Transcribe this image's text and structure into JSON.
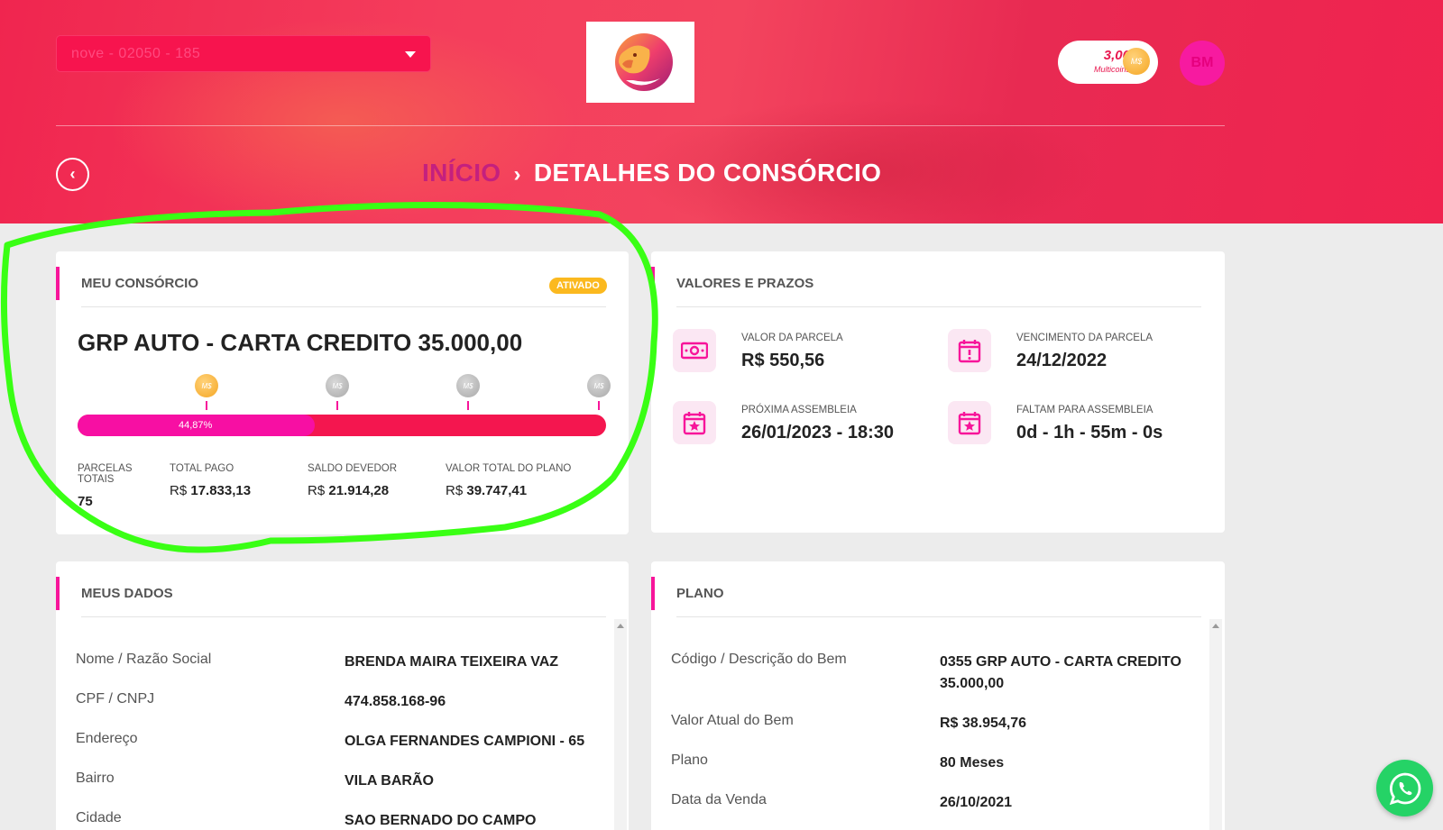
{
  "header": {
    "contract_select": {
      "value": "nove - 02050 - 185"
    },
    "coins": {
      "amount": "3,00",
      "label": "Multicoins",
      "icon_text": "M$"
    },
    "avatar_initials": "BM",
    "breadcrumb": {
      "home": "INÍCIO",
      "separator": "›",
      "current": "DETALHES DO CONSÓRCIO"
    }
  },
  "meu_consorcio": {
    "title": "MEU CONSÓRCIO",
    "status_badge": "ATIVADO",
    "plan_name": "GRP AUTO - CARTA CREDITO 35.000,00",
    "progress": {
      "percent": 44.87,
      "label": "44,87%"
    },
    "milestones": [
      {
        "icon_text": "M$",
        "reached": true
      },
      {
        "icon_text": "M$",
        "reached": false
      },
      {
        "icon_text": "M$",
        "reached": false
      },
      {
        "icon_text": "M$",
        "reached": false
      }
    ],
    "stats": [
      {
        "label": "PARCELAS TOTAIS",
        "currency": "",
        "value": "75"
      },
      {
        "label": "TOTAL PAGO",
        "currency": "R$",
        "value": "17.833,13"
      },
      {
        "label": "SALDO DEVEDOR",
        "currency": "R$",
        "value": "21.914,28"
      },
      {
        "label": "VALOR TOTAL DO PLANO",
        "currency": "R$",
        "value": "39.747,41"
      }
    ]
  },
  "valores_prazos": {
    "title": "VALORES E PRAZOS",
    "items": [
      {
        "icon": "money-icon",
        "label": "VALOR DA PARCELA",
        "value": "R$ 550,56"
      },
      {
        "icon": "calendar-alert-icon",
        "label": "VENCIMENTO DA PARCELA",
        "value": "24/12/2022"
      },
      {
        "icon": "calendar-star-icon",
        "label": "PRÓXIMA ASSEMBLEIA",
        "value": "26/01/2023 - 18:30"
      },
      {
        "icon": "calendar-star-icon",
        "label": "FALTAM PARA ASSEMBLEIA",
        "value": "0d - 1h - 55m - 0s"
      }
    ]
  },
  "meus_dados": {
    "title": "MEUS DADOS",
    "rows": [
      {
        "key": "Nome / Razão Social",
        "value": "BRENDA MAIRA TEIXEIRA VAZ"
      },
      {
        "key": "CPF / CNPJ",
        "value": "474.858.168-96"
      },
      {
        "key": "Endereço",
        "value": "OLGA FERNANDES CAMPIONI - 65"
      },
      {
        "key": "Bairro",
        "value": "VILA BARÃO"
      },
      {
        "key": "Cidade",
        "value": "SAO BERNADO DO CAMPO"
      }
    ]
  },
  "plano": {
    "title": "PLANO",
    "rows": [
      {
        "key": "Código / Descrição do Bem",
        "value": "0355 GRP AUTO - CARTA CREDITO 35.000,00"
      },
      {
        "key": "Valor Atual do Bem",
        "value": "R$ 38.954,76"
      },
      {
        "key": "Plano",
        "value": "80 Meses"
      },
      {
        "key": "Data da Venda",
        "value": "26/10/2021"
      }
    ]
  },
  "colors": {
    "header_red": "#f0254f",
    "accent_pink": "#f7159a",
    "progress_track": "#f4164f",
    "badge_yellow": "#fbb91f",
    "annotation_green": "#39ff14",
    "whatsapp_green": "#25d366"
  }
}
